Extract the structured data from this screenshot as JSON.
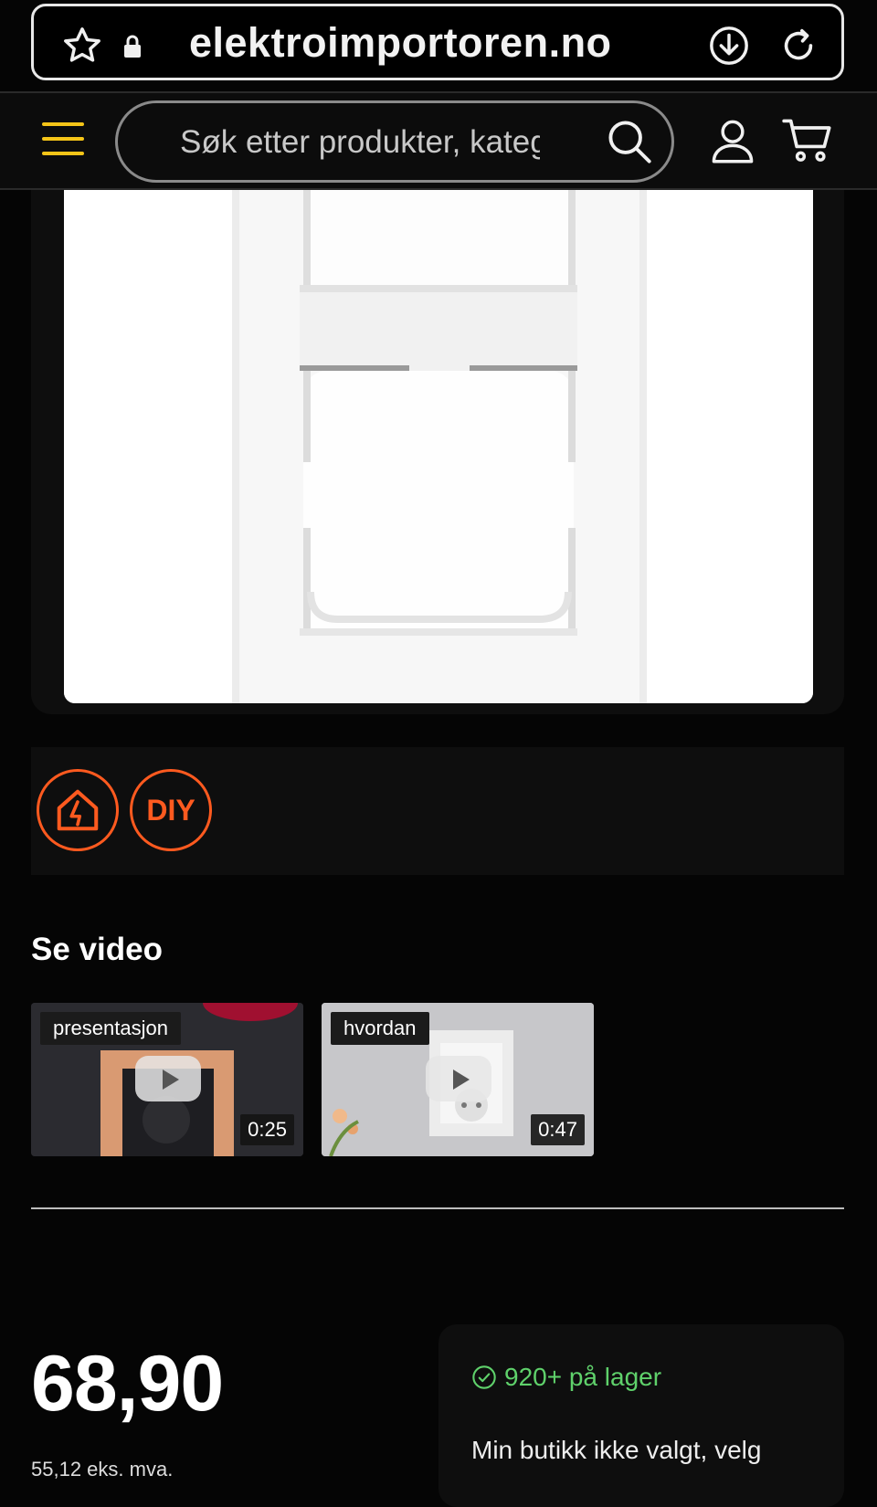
{
  "browser": {
    "domain": "elektroimportoren.no"
  },
  "header": {
    "search_placeholder": "Søk etter produkter, kategorier"
  },
  "badges": {
    "diy_label": "DIY"
  },
  "videos": {
    "title": "Se video",
    "items": [
      {
        "label": "presentasjon",
        "duration": "0:25"
      },
      {
        "label": "hvordan",
        "duration": "0:47"
      }
    ]
  },
  "product": {
    "price": "68,90",
    "price_note": "55,12 eks. mva.",
    "stock": "920+ på lager",
    "store_text": "Min butikk ikke valgt, velg"
  },
  "colors": {
    "accent_orange": "#ff5a1f",
    "stock_green": "#5fd16b",
    "background": "#050505"
  }
}
